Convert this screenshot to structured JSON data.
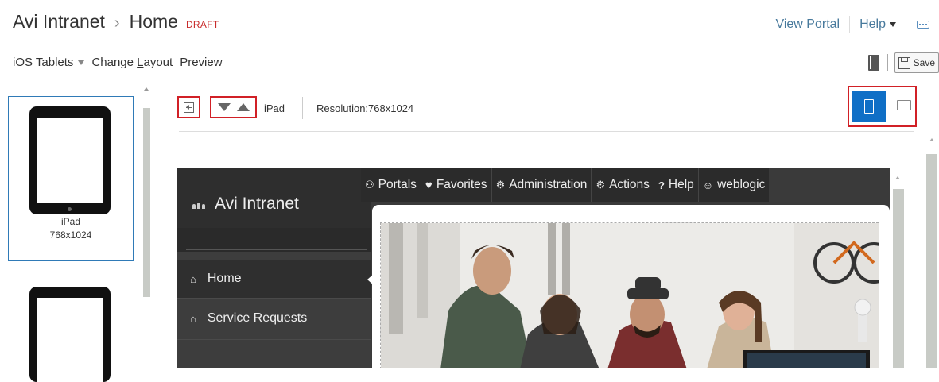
{
  "header": {
    "site": "Avi Intranet",
    "separator": "›",
    "page": "Home",
    "status_badge": "DRAFT",
    "view_portal": "View Portal",
    "help": "Help"
  },
  "toolbar": {
    "device_group": "iOS Tablets",
    "change_layout_prefix": "Change ",
    "change_layout_accel": "L",
    "change_layout_suffix": "ayout",
    "preview": "Preview",
    "save": "Save"
  },
  "devices": [
    {
      "name": "iPad",
      "resolution": "768x1024",
      "selected": true
    },
    {
      "name": "",
      "resolution": "",
      "selected": false
    }
  ],
  "main_toolbar": {
    "device_name": "iPad",
    "resolution": "Resolution:768x1024",
    "orientation": "portrait"
  },
  "preview": {
    "brand": "Avi Intranet",
    "nav": [
      {
        "label": "Portals",
        "icon": "users-icon"
      },
      {
        "label": "Favorites",
        "icon": "heart-icon"
      },
      {
        "label": "Administration",
        "icon": "cogs-icon"
      },
      {
        "label": "Actions",
        "icon": "gear-icon"
      },
      {
        "label": "Help",
        "icon": "question-icon"
      },
      {
        "label": "weblogic",
        "icon": "user-icon"
      }
    ],
    "sidebar": [
      {
        "label": "Home",
        "icon": "home-icon",
        "active": true
      },
      {
        "label": "Service Requests",
        "icon": "home-icon",
        "active": false
      }
    ]
  },
  "colors": {
    "accent": "#0f6fc6",
    "highlight_border": "#d12026",
    "link": "#47799c",
    "draft": "#c82b2b"
  }
}
